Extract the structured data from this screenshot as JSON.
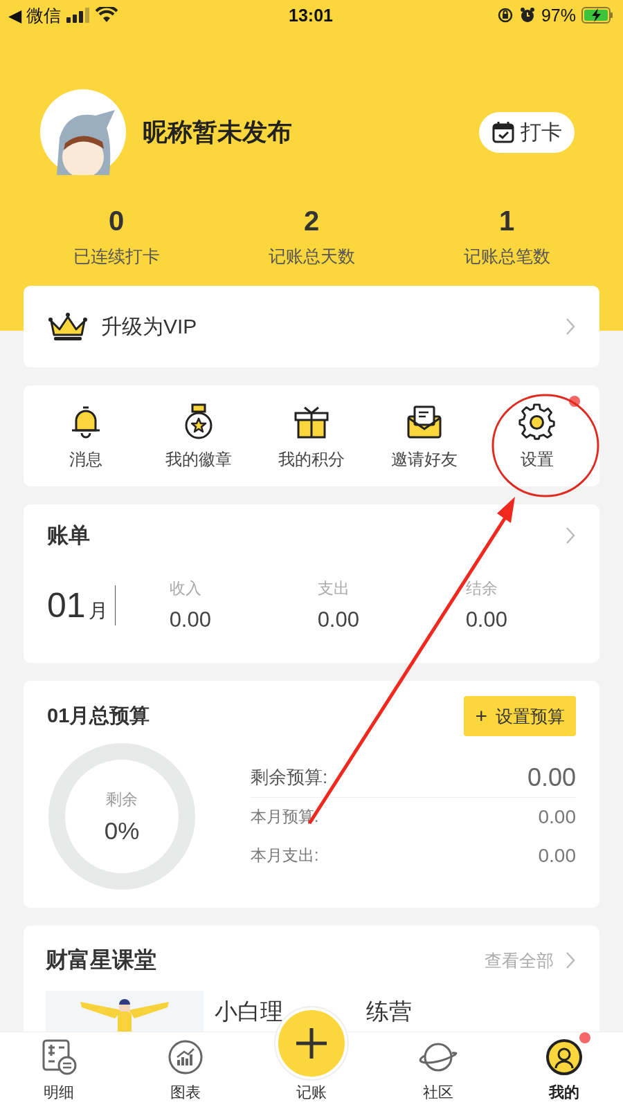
{
  "status_bar": {
    "back_app": "◀ 微信",
    "time": "13:01",
    "battery": "97%"
  },
  "profile": {
    "nickname": "昵称暂未发布",
    "checkin_button": "打卡"
  },
  "stats": [
    {
      "value": "0",
      "label": "已连续打卡"
    },
    {
      "value": "2",
      "label": "记账总天数"
    },
    {
      "value": "1",
      "label": "记账总笔数"
    }
  ],
  "vip": {
    "label": "升级为VIP"
  },
  "shortcuts": [
    {
      "kind": "bell",
      "label": "消息",
      "dot": false
    },
    {
      "kind": "medal",
      "label": "我的徽章",
      "dot": false
    },
    {
      "kind": "gift",
      "label": "我的积分",
      "dot": false
    },
    {
      "kind": "mail",
      "label": "邀请好友",
      "dot": false
    },
    {
      "kind": "gear",
      "label": "设置",
      "dot": true
    }
  ],
  "bill": {
    "title": "账单",
    "month": "01",
    "month_unit": "月",
    "columns": [
      {
        "label": "收入",
        "value": "0.00"
      },
      {
        "label": "支出",
        "value": "0.00"
      },
      {
        "label": "结余",
        "value": "0.00"
      }
    ]
  },
  "budget": {
    "title": "01月总预算",
    "button": "设置预算",
    "button_icon": "+",
    "ring_label": "剩余",
    "ring_value": "0%",
    "rows": [
      {
        "label": "剩余预算:",
        "value": "0.00",
        "kind": "main"
      },
      {
        "label": "本月预算:",
        "value": "0.00",
        "kind": "sub"
      },
      {
        "label": "本月支出:",
        "value": "0.00",
        "kind": "sub"
      }
    ]
  },
  "courses": {
    "title": "财富星课堂",
    "more": "查看全部",
    "item_title_parts": [
      "小白理",
      "练营"
    ],
    "item_picture": {
      "kind": "picture"
    }
  },
  "tab_bar": [
    {
      "kind": "list",
      "label": "明细",
      "selected": false,
      "dot": false
    },
    {
      "kind": "chart",
      "label": "图表",
      "selected": false,
      "dot": false
    },
    {
      "kind": "add",
      "label": "记账",
      "selected": false,
      "dot": false
    },
    {
      "kind": "planet",
      "label": "社区",
      "selected": false,
      "dot": false
    },
    {
      "kind": "me",
      "label": "我的",
      "selected": true,
      "dot": true
    }
  ]
}
